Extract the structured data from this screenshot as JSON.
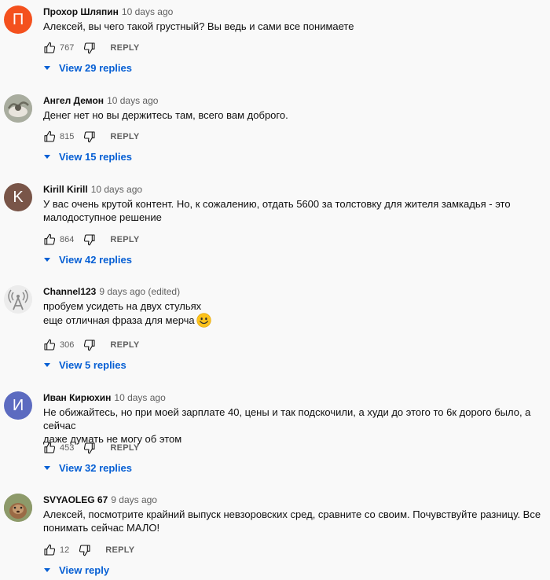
{
  "comments": [
    {
      "author": "Прохор Шляпин",
      "time": "10 days ago",
      "avatar_letter": "П",
      "avatar_color": "#f4511e",
      "lines": [
        "Алексей, вы чего такой грустный? Вы ведь и сами все понимаете"
      ],
      "likes": "767",
      "reply": "REPLY",
      "view": "View 29 replies"
    },
    {
      "author": "Ангел Демон",
      "time": "10 days ago",
      "avatar_letter": "",
      "avatar_color": "#9aa3a0",
      "lines": [
        "Денег нет но вы держитесь там, всего вам доброго."
      ],
      "likes": "815",
      "reply": "REPLY",
      "view": "View 15 replies"
    },
    {
      "author": "Kirill Kirill",
      "time": "10 days ago",
      "avatar_letter": "K",
      "avatar_color": "#795548",
      "lines": [
        "У вас очень крутой контент. Но, к сожалению, отдать 5600 за толстовку для жителя замкадья - это",
        "малодоступное решение"
      ],
      "likes": "864",
      "reply": "REPLY",
      "view": "View 42 replies"
    },
    {
      "author": "Channel123",
      "time": "9 days ago (edited)",
      "avatar_letter": "",
      "avatar_color": "#ececec",
      "lines": [
        "пробуем усидеть на двух стульях",
        "еще отличная фраза для мерча"
      ],
      "likes": "306",
      "reply": "REPLY",
      "view": "View 5 replies"
    },
    {
      "author": "Иван Кирюхин",
      "time": "10 days ago",
      "avatar_letter": "И",
      "avatar_color": "#5c6bc0",
      "lines": [
        "Не обижайтесь,  но при моей зарплате 40, цены и так подскочили, а худи до этого то 6к дорого было, а сейчас",
        "даже думать не могу об этом"
      ],
      "likes": "453",
      "reply": "REPLY",
      "view": "View 32 replies"
    },
    {
      "author": "SVYAOLEG 67",
      "time": "9 days ago",
      "avatar_letter": "",
      "avatar_color": "#7d8a5a",
      "lines": [
        "Алексей, посмотрите крайний выпуск невзоровских сред, сравните со своим. Почувствуйте разницу. Все",
        "понимать сейчас МАЛО!"
      ],
      "likes": "12",
      "reply": "REPLY",
      "view": "View reply"
    }
  ]
}
